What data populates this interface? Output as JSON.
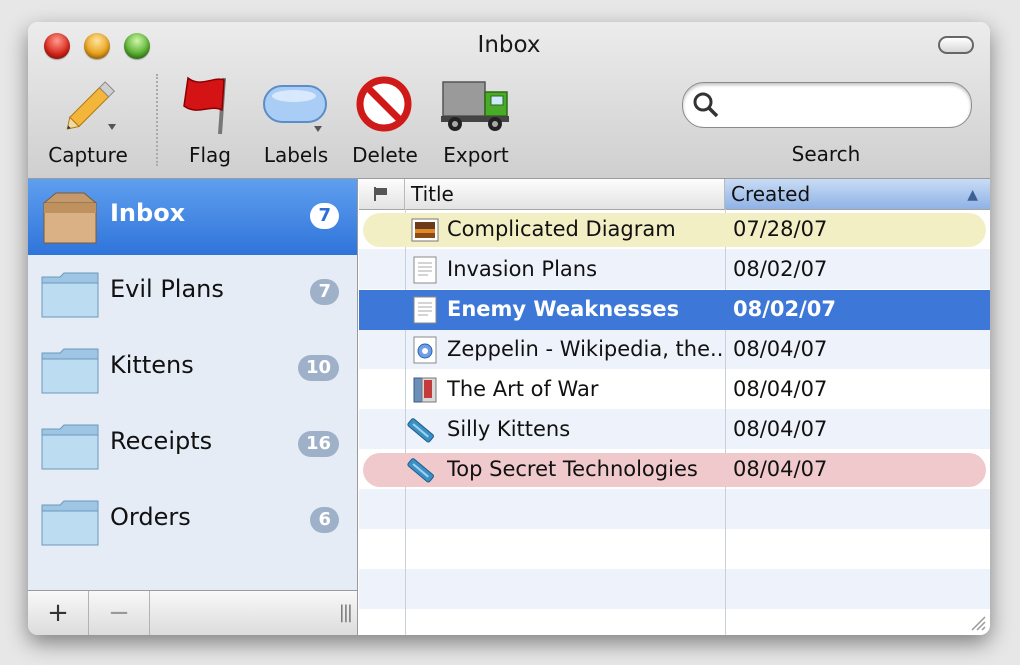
{
  "window": {
    "title": "Inbox"
  },
  "toolbar": {
    "capture": "Capture",
    "flag": "Flag",
    "labels": "Labels",
    "delete": "Delete",
    "export": "Export",
    "search_label": "Search",
    "search_placeholder": ""
  },
  "sidebar": {
    "items": [
      {
        "label": "Inbox",
        "count": "7",
        "selected": true
      },
      {
        "label": "Evil Plans",
        "count": "7"
      },
      {
        "label": "Kittens",
        "count": "10"
      },
      {
        "label": "Receipts",
        "count": "16"
      },
      {
        "label": "Orders",
        "count": "6"
      }
    ],
    "add": "+",
    "remove": "−",
    "grip": "|||"
  },
  "table": {
    "headers": {
      "title": "Title",
      "created": "Created",
      "sort_indicator": "▲"
    },
    "rows": [
      {
        "title": "Complicated Diagram",
        "created": "07/28/07",
        "icon": "image-icon",
        "label_color": "#f3efc5"
      },
      {
        "title": "Invasion Plans",
        "created": "08/02/07",
        "icon": "text-document-icon"
      },
      {
        "title": "Enemy Weaknesses",
        "created": "08/02/07",
        "icon": "text-document-icon",
        "selected": true
      },
      {
        "title": "Zeppelin - Wikipedia, the...",
        "created": "08/04/07",
        "icon": "web-archive-icon"
      },
      {
        "title": "The Art of War",
        "created": "08/04/07",
        "icon": "book-icon"
      },
      {
        "title": "Silly Kittens",
        "created": "08/04/07",
        "icon": "bookmark-icon"
      },
      {
        "title": "Top Secret Technologies",
        "created": "08/04/07",
        "icon": "bookmark-icon",
        "label_color": "#efc9cc"
      }
    ]
  },
  "colors": {
    "selection": "#3d78d8",
    "sidebar_selection": "#2f74da",
    "sidebar_bg": "#e5ecf5"
  }
}
